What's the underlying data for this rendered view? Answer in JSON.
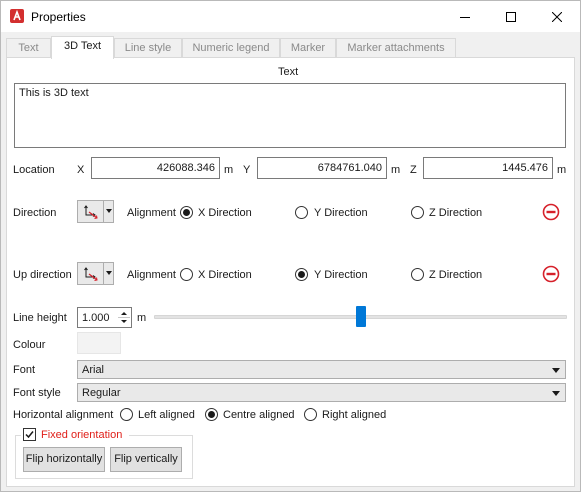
{
  "window": {
    "title": "Properties",
    "icon": "app-logo-icon",
    "controls": [
      "minimize-icon",
      "maximize-icon",
      "close-icon"
    ]
  },
  "tabs": [
    {
      "label": "Text",
      "active": false
    },
    {
      "label": "3D Text",
      "active": true
    },
    {
      "label": "Line style",
      "active": false
    },
    {
      "label": "Numeric legend",
      "active": false
    },
    {
      "label": "Marker",
      "active": false
    },
    {
      "label": "Marker attachments",
      "active": false
    }
  ],
  "text_section": {
    "heading": "Text",
    "value": "This is 3D text"
  },
  "location": {
    "label": "Location",
    "x_label": "X",
    "x_value": "426088.346",
    "x_unit": "m",
    "y_label": "Y",
    "y_value": "6784761.040",
    "y_unit": "m",
    "z_label": "Z",
    "z_value": "1445.476",
    "z_unit": "m"
  },
  "direction": {
    "label": "Direction",
    "alignment_label": "Alignment",
    "options": [
      "X Direction",
      "Y Direction",
      "Z Direction"
    ],
    "selected": "X Direction"
  },
  "up_direction": {
    "label": "Up direction",
    "alignment_label": "Alignment",
    "options": [
      "X Direction",
      "Y Direction",
      "Z Direction"
    ],
    "selected": "Y Direction"
  },
  "line_height": {
    "label": "Line height",
    "value": "1.000",
    "unit": "m",
    "slider_fraction": 0.5
  },
  "colour": {
    "label": "Colour",
    "value_hex": "#f3f3f3"
  },
  "font": {
    "label": "Font",
    "value": "Arial"
  },
  "font_style": {
    "label": "Font style",
    "value": "Regular"
  },
  "horizontal_alignment": {
    "label": "Horizontal alignment",
    "options": [
      "Left aligned",
      "Centre aligned",
      "Right aligned"
    ],
    "selected": "Centre aligned"
  },
  "fixed_orientation": {
    "label": "Fixed orientation",
    "checked": true,
    "label_color": "#e0201a",
    "flip_h_label": "Flip horizontally",
    "flip_v_label": "Flip vertically"
  },
  "colors": {
    "accent": "#0078d7",
    "remove": "#d6202a",
    "app_icon": "#d32f2f"
  }
}
